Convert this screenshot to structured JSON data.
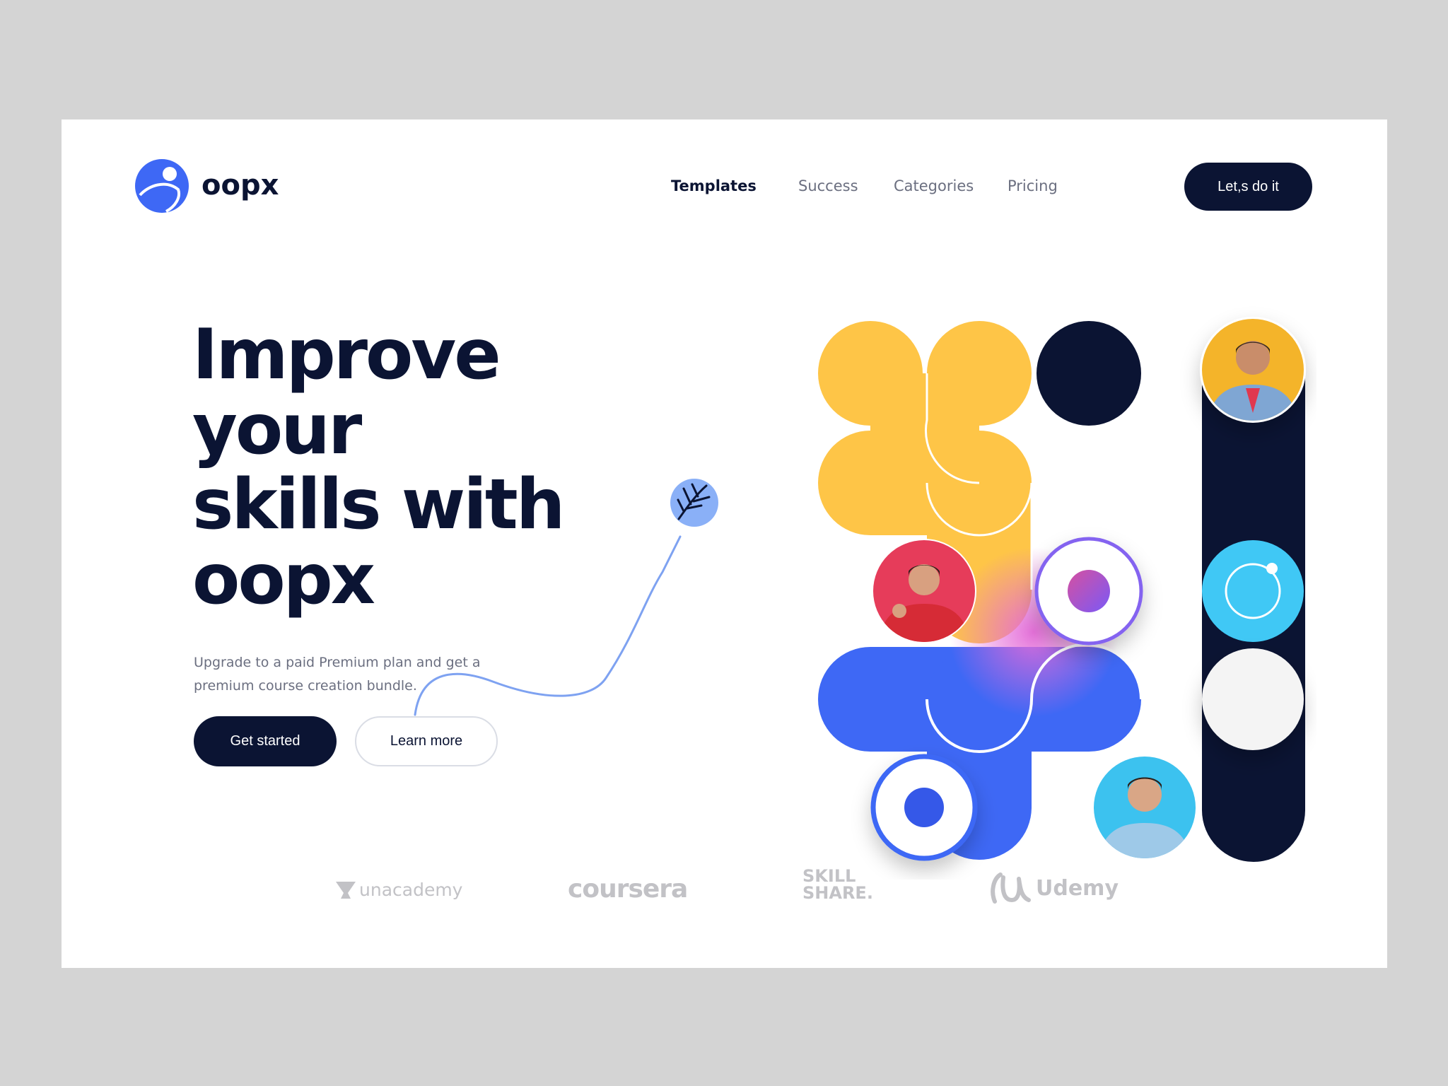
{
  "brand": {
    "name": "oopx"
  },
  "nav": {
    "items": [
      {
        "label": "Templates",
        "active": true
      },
      {
        "label": "Success",
        "active": false
      },
      {
        "label": "Categories",
        "active": false
      },
      {
        "label": "Pricing",
        "active": false
      }
    ],
    "cta_label": "Let,s do it"
  },
  "hero": {
    "title_lines": [
      "Improve",
      "your",
      "skills with",
      "oopx"
    ],
    "subtitle": "Upgrade to a paid Premium plan and get a premium course creation bundle.",
    "primary_label": "Get started",
    "secondary_label": "Learn more"
  },
  "partners": [
    "unacademy",
    "coursera",
    "SKILL SHARE.",
    "Udemy"
  ],
  "colors": {
    "navy": "#0b1433",
    "yellow": "#fec547",
    "blue": "#3e68f5",
    "cyan": "#40c8f5",
    "pink": "#e0384f",
    "light_blue": "#8ab0f7",
    "gray_bg": "#d4d4d4"
  },
  "icons": [
    "logo-icon",
    "feather-icon",
    "unacademy-icon",
    "udemy-icon"
  ]
}
